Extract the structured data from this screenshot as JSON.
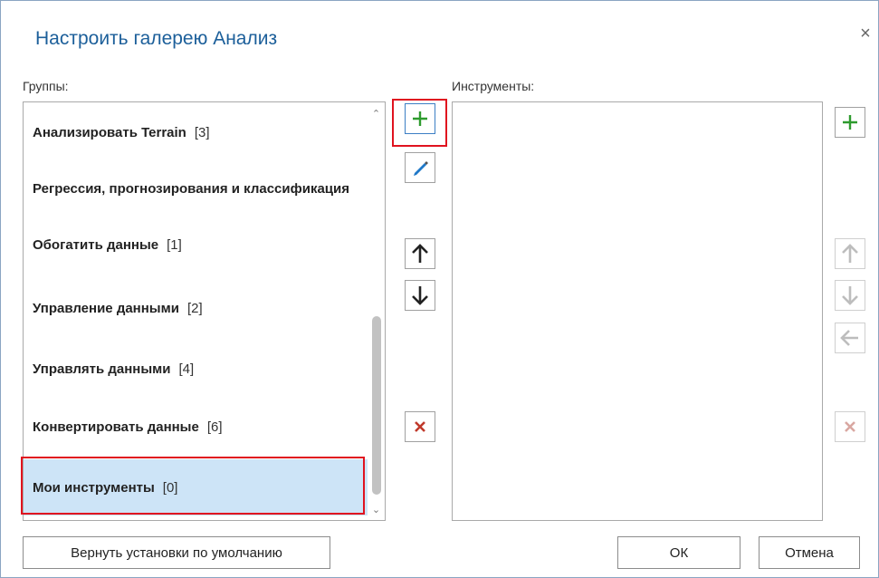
{
  "dialog": {
    "title": "Настроить галерею Анализ",
    "close_symbol": "×"
  },
  "groups": {
    "label": "Группы:",
    "items": [
      {
        "name": "Анализировать Terrain",
        "count": "[3]"
      },
      {
        "name": "Регрессия, прогнозирования и классификация",
        "count": ""
      },
      {
        "name": "Обогатить данные",
        "count": "[1]"
      },
      {
        "name": "Управление данными",
        "count": "[2]"
      },
      {
        "name": "Управлять данными",
        "count": "[4]"
      },
      {
        "name": "Конвертировать данные",
        "count": "[6]"
      },
      {
        "name": "Мои инструменты",
        "count": "[0]",
        "selected": true
      }
    ],
    "scroll_up_symbol": "⌃",
    "scroll_down_symbol": "⌄"
  },
  "tools": {
    "label": "Инструменты:"
  },
  "group_buttons": [
    "add-icon",
    "edit-pencil-icon",
    "move-up-icon",
    "move-down-icon",
    "delete-icon"
  ],
  "tool_buttons": [
    "add-icon",
    "move-up-icon",
    "move-down-icon",
    "move-left-icon",
    "delete-icon"
  ],
  "footer": {
    "reset_label": "Вернуть установки по умолчанию",
    "ok_label": "ОК",
    "cancel_label": "Отмена"
  },
  "colors": {
    "title": "#1c5f9a",
    "selection": "#cde4f7",
    "highlight": "#e0131f",
    "add": "#2e9b2e",
    "delete": "#c0392b"
  }
}
